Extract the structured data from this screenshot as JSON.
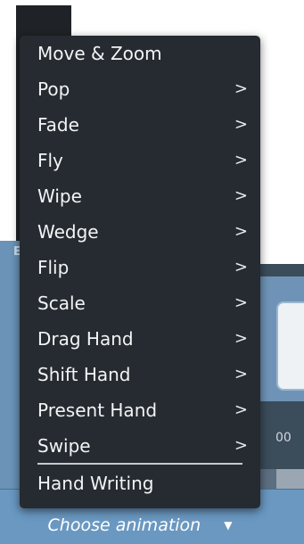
{
  "menu": {
    "items": [
      {
        "label": "Move & Zoom",
        "chevron": ""
      },
      {
        "label": "Pop",
        "chevron": ">"
      },
      {
        "label": "Fade",
        "chevron": ">"
      },
      {
        "label": "Fly",
        "chevron": ">"
      },
      {
        "label": "Wipe",
        "chevron": ">"
      },
      {
        "label": "Wedge",
        "chevron": ">"
      },
      {
        "label": "Flip",
        "chevron": ">"
      },
      {
        "label": "Scale",
        "chevron": ">"
      },
      {
        "label": "Drag Hand",
        "chevron": ">"
      },
      {
        "label": "Shift Hand",
        "chevron": ">"
      },
      {
        "label": "Present Hand",
        "chevron": ">"
      },
      {
        "label": "Swipe",
        "chevron": ">"
      },
      {
        "label": "Hand Writing",
        "chevron": ""
      }
    ]
  },
  "footer": {
    "choose_label": "Choose animation",
    "dropdown_arrow": "▼"
  },
  "background": {
    "left_letter": "E",
    "right_time": "00"
  },
  "colors": {
    "menu_bg": "#252b31",
    "footer_bg": "#6a98c1",
    "menu_text": "#f3f4f5"
  }
}
